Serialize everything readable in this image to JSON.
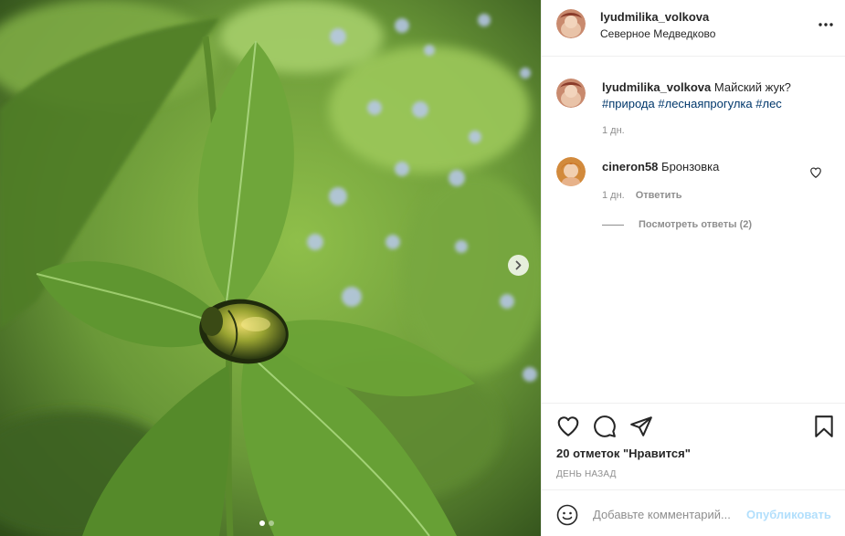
{
  "post": {
    "username": "lyudmilika_volkova",
    "location": "Северное Медведково",
    "caption_text": "Майский жук?",
    "hashtags": [
      "#природа",
      "#леснаяпрогулка",
      "#лес"
    ],
    "caption_time": "1 дн.",
    "likes_text": "20 отметок \"Нравится\"",
    "posted_ago": "ДЕНЬ НАЗАД"
  },
  "comments": [
    {
      "username": "cineron58",
      "text": "Бронзовка",
      "time": "1 дн.",
      "reply_label": "Ответить",
      "view_replies": "Посмотреть ответы (2)"
    }
  ],
  "carousel": {
    "current": 1,
    "total": 2
  },
  "add_comment": {
    "placeholder": "Добавьте комментарий...",
    "publish_label": "Опубликовать"
  },
  "icons": {
    "more": "more-dots-icon",
    "like": "heart-icon",
    "comment": "comment-bubble-icon",
    "share": "paper-plane-icon",
    "save": "bookmark-icon",
    "emoji": "emoji-smile-icon",
    "next": "chevron-right-icon"
  },
  "colors": {
    "text": "#262626",
    "secondary": "#8e8e8e",
    "hashtag": "#00376b",
    "publish_disabled": "#b2dffc",
    "divider": "#efefef"
  }
}
